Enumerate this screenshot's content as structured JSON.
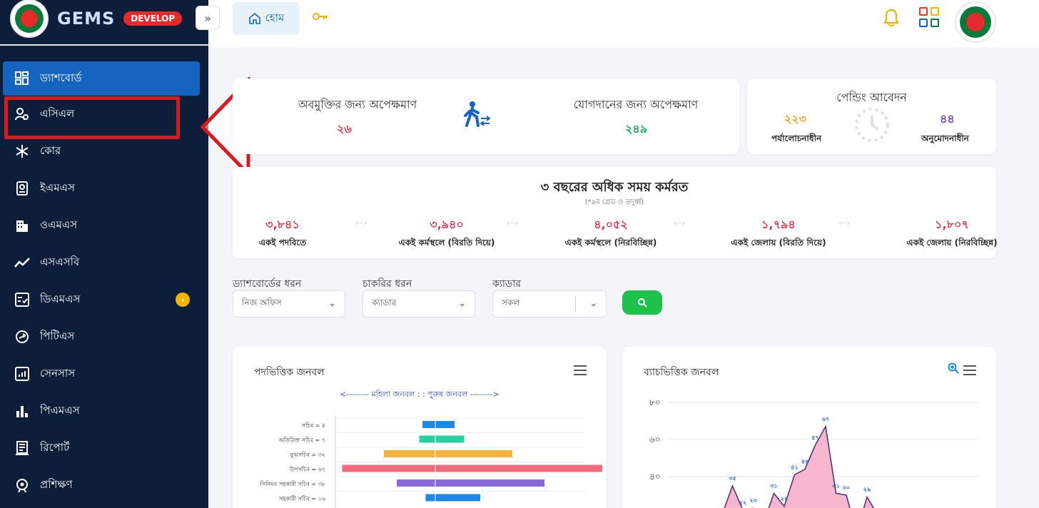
{
  "brand": {
    "name": "GEMS",
    "env_badge": "DEVELOP"
  },
  "sidebar": {
    "items": [
      {
        "label": "ড্যাশবোর্ড",
        "icon": "dashboard-icon",
        "active": true
      },
      {
        "label": "এসিএল",
        "icon": "users-icon"
      },
      {
        "label": "কোর",
        "icon": "snowflake-icon"
      },
      {
        "label": "ইএমএস",
        "icon": "id-card-icon"
      },
      {
        "label": "ওএমএস",
        "icon": "building-icon"
      },
      {
        "label": "এসএসবি",
        "icon": "trend-icon"
      },
      {
        "label": "ডিএমএস",
        "icon": "checklist-icon",
        "badge": "›"
      },
      {
        "label": "পিটিএস",
        "icon": "exchange-icon"
      },
      {
        "label": "সেনসাস",
        "icon": "census-icon"
      },
      {
        "label": "পিএমএস",
        "icon": "bar-chart-icon"
      },
      {
        "label": "রিপোর্ট",
        "icon": "report-icon"
      },
      {
        "label": "প্রশিক্ষণ",
        "icon": "training-icon"
      }
    ]
  },
  "header": {
    "home_label": "হোম",
    "collapse_glyph": "»"
  },
  "waiting": {
    "release_title": "অবমুক্তির জন্য অপেক্ষমাণ",
    "release_value": "২৬",
    "join_title": "যোগদানের জন্য অপেক্ষমাণ",
    "join_value": "২৪৯"
  },
  "pending": {
    "title": "পেন্ডিং আবেদন",
    "review_value": "২২৩",
    "review_label": "পর্যালোচনাধীন",
    "approval_value": "৪৪",
    "approval_label": "অনুমোদনাধীন"
  },
  "tenure": {
    "title": "৩ বছরের অধিক সময় কর্মরত",
    "subtitle": "(*৯ম গ্রেড ও তদুর্ধ্ব)",
    "items": [
      {
        "value": "৩,৮৪১",
        "label": "একই পদবিতে"
      },
      {
        "value": "৩,৯৪০",
        "label": "একই কর্মস্থলে (বিরতি দিয়ে)"
      },
      {
        "value": "৪,০৫২",
        "label": "একই কর্মস্থলে (নিরবিচ্ছিন্ন)"
      },
      {
        "value": "১,৭৯৪",
        "label": "একই জেলায় (বিরতি দিয়ে)"
      },
      {
        "value": "১,৮০৭",
        "label": "একই জেলায় (নিরবিচ্ছিন্ন)"
      }
    ],
    "separator": "‹··›"
  },
  "filters": {
    "dashboard_type_label": "ড্যাশবোর্ডের ধরন",
    "dashboard_type_value": "নিজ অফিস",
    "job_type_label": "চাকরির ধরন",
    "job_type_value": "ক্যাডার",
    "cadre_label": "ক্যাডার",
    "cadre_value": "সকল"
  },
  "designation_chart": {
    "title": "পদভিত্তিক জনবল",
    "legend": "<-------- মহিলা জনবল : : পুরুষ জনবল -------->",
    "rows": [
      {
        "label": "সচিব = ৪",
        "left": 0.4,
        "right": 0.6,
        "color": "#1e88e5"
      },
      {
        "label": "অতিরিক্ত সচিব = ৭",
        "left": 0.5,
        "right": 0.9,
        "color": "#26d0a0"
      },
      {
        "label": "যুগ্মসচিব = ৩২",
        "left": 1.6,
        "right": 2.4,
        "color": "#f4b43c"
      },
      {
        "label": "উপসচিব = ৬৭",
        "left": 2.9,
        "right": 5.2,
        "color": "#f26b7a"
      },
      {
        "label": "সিনিয়র সহকারী সচিব = ৩৮",
        "left": 1.2,
        "right": 3.4,
        "color": "#8a6ad8"
      },
      {
        "label": "সহকারী সচিব = ১৬",
        "left": 0.3,
        "right": 1.4,
        "color": "#1e88e5"
      }
    ]
  },
  "batch_chart": {
    "title": "ব্যাচভিত্তিক জনবল",
    "y_ticks": [
      "৮০",
      "৬০",
      "৪০"
    ],
    "points": [
      {
        "x": 0,
        "y": 0,
        "label": ""
      },
      {
        "x": 1,
        "y": 35,
        "label": "৩৫"
      },
      {
        "x": 2,
        "y": 22,
        "label": "২২"
      },
      {
        "x": 3,
        "y": 23,
        "label": "২৩"
      },
      {
        "x": 4,
        "y": 15,
        "label": ""
      },
      {
        "x": 5,
        "y": 31,
        "label": "৩১"
      },
      {
        "x": 6,
        "y": 24,
        "label": "২৪"
      },
      {
        "x": 7,
        "y": 41,
        "label": "৪১"
      },
      {
        "x": 8,
        "y": 44,
        "label": "৪৪"
      },
      {
        "x": 9,
        "y": 57,
        "label": "৫৭"
      },
      {
        "x": 10,
        "y": 67,
        "label": "৬৭"
      },
      {
        "x": 11,
        "y": 31,
        "label": "৩১"
      },
      {
        "x": 12,
        "y": 30,
        "label": "৩০"
      },
      {
        "x": 13,
        "y": 10,
        "label": ""
      },
      {
        "x": 14,
        "y": 29,
        "label": "২৯"
      },
      {
        "x": 15,
        "y": 0,
        "label": ""
      }
    ]
  },
  "colors": {
    "sidebar_bg": "#0c1e3a",
    "active": "#1565c0",
    "accent_red": "#d71920",
    "green": "#1ec24a"
  }
}
